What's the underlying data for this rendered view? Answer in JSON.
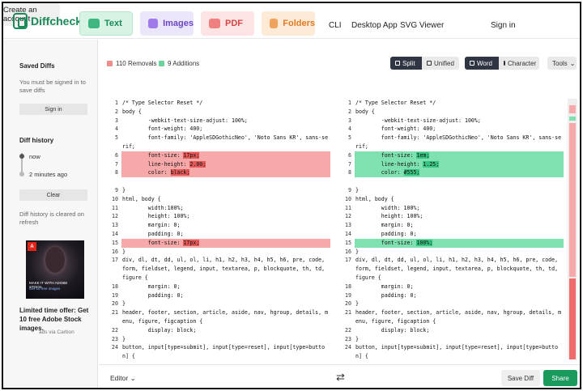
{
  "brand": {
    "name": "Diffchecker"
  },
  "nav": {
    "tabs": [
      {
        "label": "Text"
      },
      {
        "label": "Images"
      },
      {
        "label": "PDF"
      },
      {
        "label": "Folders"
      }
    ],
    "links": [
      "CLI",
      "Desktop App",
      "SVG Viewer",
      "Sign in"
    ],
    "create_account": "Create an account"
  },
  "sidebar": {
    "saved_title": "Saved Diffs",
    "saved_note": "You must be signed in to save diffs",
    "signin_button": "Sign in",
    "history_title": "Diff history",
    "history_items": [
      "now",
      "2 minutes ago"
    ],
    "clear_button": "Clear",
    "history_note": "Diff history is cleared on refresh",
    "ad_line1": "MAKE IT WITH ADOBE STOCK.",
    "ad_line2": "Get 10 free images",
    "ad_badge": "A",
    "ad_text": "Limited time offer: Get 10 free Adobe Stock images.",
    "ad_carbon": "ads via Carbon"
  },
  "toolbar": {
    "removals": "110 Removals",
    "additions": "9 Additions",
    "split": "Split",
    "unified": "Unified",
    "word": "Word",
    "character": "Character",
    "tools": "Tools"
  },
  "left_lines": [
    {
      "n": "1",
      "t": "/* Type Selector Reset */"
    },
    {
      "n": "2",
      "t": "body {"
    },
    {
      "n": "3",
      "t": "        -webkit-text-size-adjust: 100%;"
    },
    {
      "n": "4",
      "t": "        font-weight: 400;"
    },
    {
      "n": "5",
      "t": "        font-family: 'AppleSDGothicNeo', 'Noto Sans KR', sans-se"
    },
    {
      "n": "",
      "t": "rif;"
    },
    {
      "n": "6",
      "t": "        font-size: ",
      "h": "17px;",
      "k": "del"
    },
    {
      "n": "7",
      "t": "        line-height: ",
      "h": "2.00;",
      "k": "del"
    },
    {
      "n": "8",
      "t": "        color: ",
      "h": "black;",
      "k": "del"
    },
    {
      "n": "",
      "t": "",
      "k": "del"
    },
    {
      "n": "9",
      "t": "}"
    },
    {
      "n": "10",
      "t": "html, body {"
    },
    {
      "n": "11",
      "t": "        width:100%;"
    },
    {
      "n": "12",
      "t": "        height: 100%;"
    },
    {
      "n": "13",
      "t": "        margin: 0;"
    },
    {
      "n": "14",
      "t": "        padding: 0;"
    },
    {
      "n": "15",
      "t": "        font-size: ",
      "h": "17px;",
      "k": "del"
    },
    {
      "n": "16",
      "t": "}"
    },
    {
      "n": "17",
      "t": "div, dl, dt, dd, ul, ol, li, h1, h2, h3, h4, h5, h6, pre, code,"
    },
    {
      "n": "",
      "t": "form, fieldset, legend, input, textarea, p, blockquote, th, td,"
    },
    {
      "n": "",
      "t": "figure {"
    },
    {
      "n": "18",
      "t": "        margin: 0;"
    },
    {
      "n": "19",
      "t": "        padding: 0;"
    },
    {
      "n": "20",
      "t": "}"
    },
    {
      "n": "21",
      "t": "header, footer, section, article, aside, nav, hgroup, details, m"
    },
    {
      "n": "",
      "t": "enu, figure, figcaption {"
    },
    {
      "n": "22",
      "t": "        display: block;"
    },
    {
      "n": "23",
      "t": "}"
    },
    {
      "n": "24",
      "t": "button, input[type=submit], input[type=reset], input[type=butto"
    },
    {
      "n": "",
      "t": "n] {"
    }
  ],
  "right_lines": [
    {
      "n": "1",
      "t": "/* Type Selector Reset */"
    },
    {
      "n": "2",
      "t": "body {"
    },
    {
      "n": "3",
      "t": "        -webkit-text-size-adjust: 100%;"
    },
    {
      "n": "4",
      "t": "        font-weight: 400;"
    },
    {
      "n": "5",
      "t": "        font-family: 'AppleSDGothicNeo', 'Noto Sans KR', sans-se"
    },
    {
      "n": "",
      "t": "rif;"
    },
    {
      "n": "6",
      "t": "        font-size: ",
      "h": "1em;",
      "k": "ins"
    },
    {
      "n": "7",
      "t": "        line-height: ",
      "h": "1.25;",
      "k": "ins"
    },
    {
      "n": "8",
      "t": "        color: ",
      "h": "#555;",
      "k": "ins"
    },
    {
      "n": "",
      "t": "",
      "k": "ins"
    },
    {
      "n": "9",
      "t": "}"
    },
    {
      "n": "10",
      "t": "html, body {"
    },
    {
      "n": "11",
      "t": "        width: 100%;"
    },
    {
      "n": "12",
      "t": "        height: 100%;"
    },
    {
      "n": "13",
      "t": "        margin: 0;"
    },
    {
      "n": "14",
      "t": "        padding: 0;"
    },
    {
      "n": "15",
      "t": "        font-size: ",
      "h": "100%;",
      "k": "ins"
    },
    {
      "n": "16",
      "t": "}"
    },
    {
      "n": "17",
      "t": "div, dl, dt, dd, ul, ol, li, h1, h2, h3, h4, h5, h6, pre, code,"
    },
    {
      "n": "",
      "t": "form, fieldset, legend, input, textarea, p, blockquote, th, td,"
    },
    {
      "n": "",
      "t": "figure {"
    },
    {
      "n": "18",
      "t": "        margin: 0;"
    },
    {
      "n": "19",
      "t": "        padding: 0;"
    },
    {
      "n": "20",
      "t": "}"
    },
    {
      "n": "21",
      "t": "header, footer, section, article, aside, nav, hgroup, details, m"
    },
    {
      "n": "",
      "t": "enu, figure, figcaption {"
    },
    {
      "n": "22",
      "t": "        display: block;"
    },
    {
      "n": "23",
      "t": "}"
    },
    {
      "n": "24",
      "t": "button, input[type=submit], input[type=reset], input[type=butto"
    },
    {
      "n": "",
      "t": "n] {"
    }
  ],
  "footer": {
    "editor": "Editor",
    "swap_icon": "⇄",
    "save_diff": "Save Diff",
    "share": "Share"
  }
}
